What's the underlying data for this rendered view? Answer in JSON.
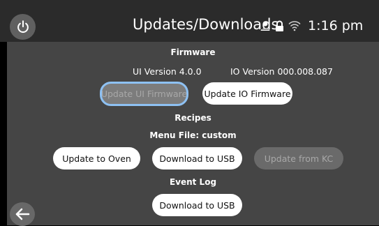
{
  "header": {
    "title": "Updates/Downloads",
    "time": "1:16 pm"
  },
  "firmware": {
    "heading": "Firmware",
    "ui_version": "UI Version 4.0.0",
    "io_version": "IO Version 000.008.087",
    "update_ui_label": "Update UI Firmware",
    "update_io_label": "Update IO Firmware"
  },
  "recipes": {
    "heading": "Recipes",
    "menu_file": "Menu File: custom",
    "update_oven_label": "Update to Oven",
    "download_usb_label": "Download to USB",
    "update_kc_label": "Update from KC"
  },
  "event_log": {
    "heading": "Event Log",
    "download_usb_label": "Download to USB"
  },
  "icons": {
    "power": "power-icon",
    "user": "user-icon",
    "lock": "lock-icon",
    "wifi": "wifi-icon",
    "back": "arrow-left-icon"
  },
  "colors": {
    "header_bg": "#2b2b2b",
    "panel_bg": "#454545",
    "focus_ring": "#8ec1f3",
    "button_active": "#ffffff",
    "button_disabled": "#6a6a6a"
  }
}
